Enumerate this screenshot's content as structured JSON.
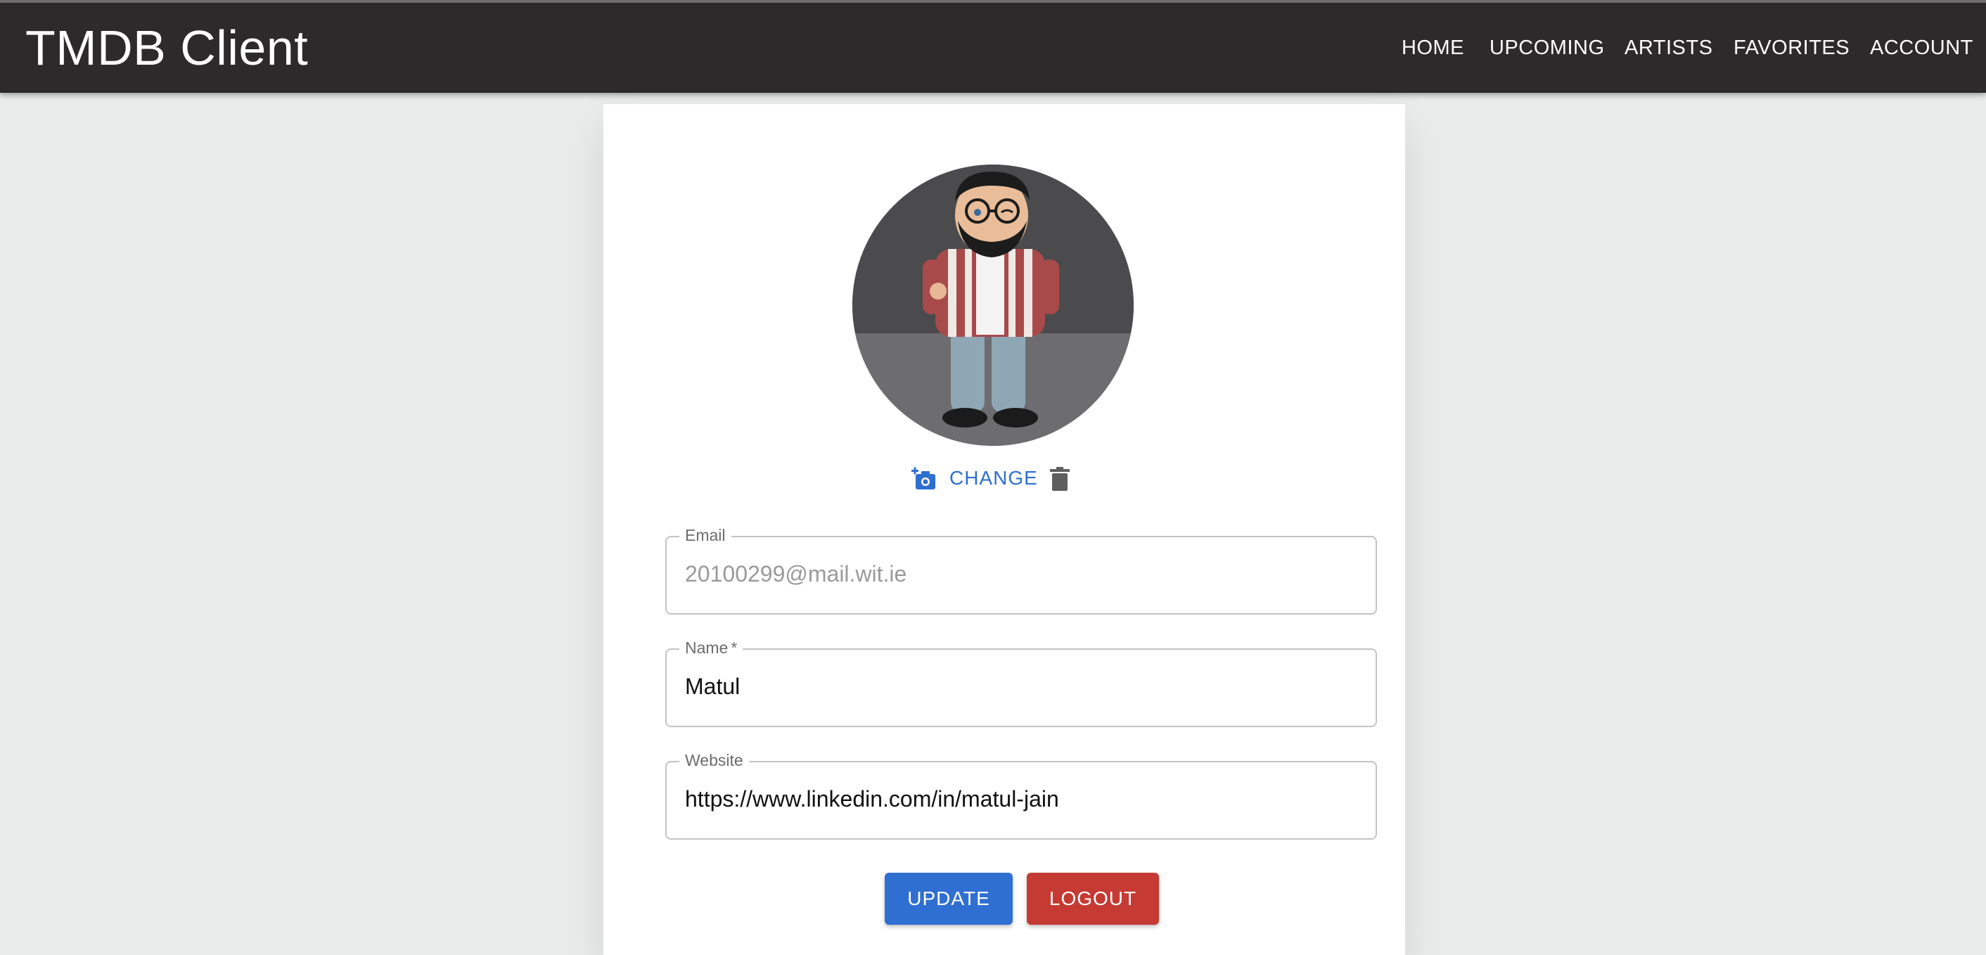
{
  "app": {
    "title": "TMDB Client"
  },
  "nav": {
    "items": [
      {
        "label": "HOME"
      },
      {
        "label": "UPCOMING"
      },
      {
        "label": "ARTISTS"
      },
      {
        "label": "FAVORITES"
      },
      {
        "label": "ACCOUNT"
      }
    ]
  },
  "profile": {
    "photo": {
      "change_label": "CHANGE",
      "change_icon": "add-a-photo-icon",
      "delete_icon": "trash-icon"
    },
    "fields": {
      "email": {
        "label": "Email",
        "value": "20100299@mail.wit.ie",
        "disabled": true
      },
      "name": {
        "label": "Name",
        "required_mark": "*",
        "value": "Matul"
      },
      "website": {
        "label": "Website",
        "value": "https://www.linkedin.com/in/matul-jain"
      }
    },
    "actions": {
      "update_label": "UPDATE",
      "logout_label": "LOGOUT"
    }
  },
  "colors": {
    "appbar": "#2c2a2b",
    "page_background": "#eaeceb",
    "primary": "#2f6fd2",
    "danger": "#c63a34"
  }
}
